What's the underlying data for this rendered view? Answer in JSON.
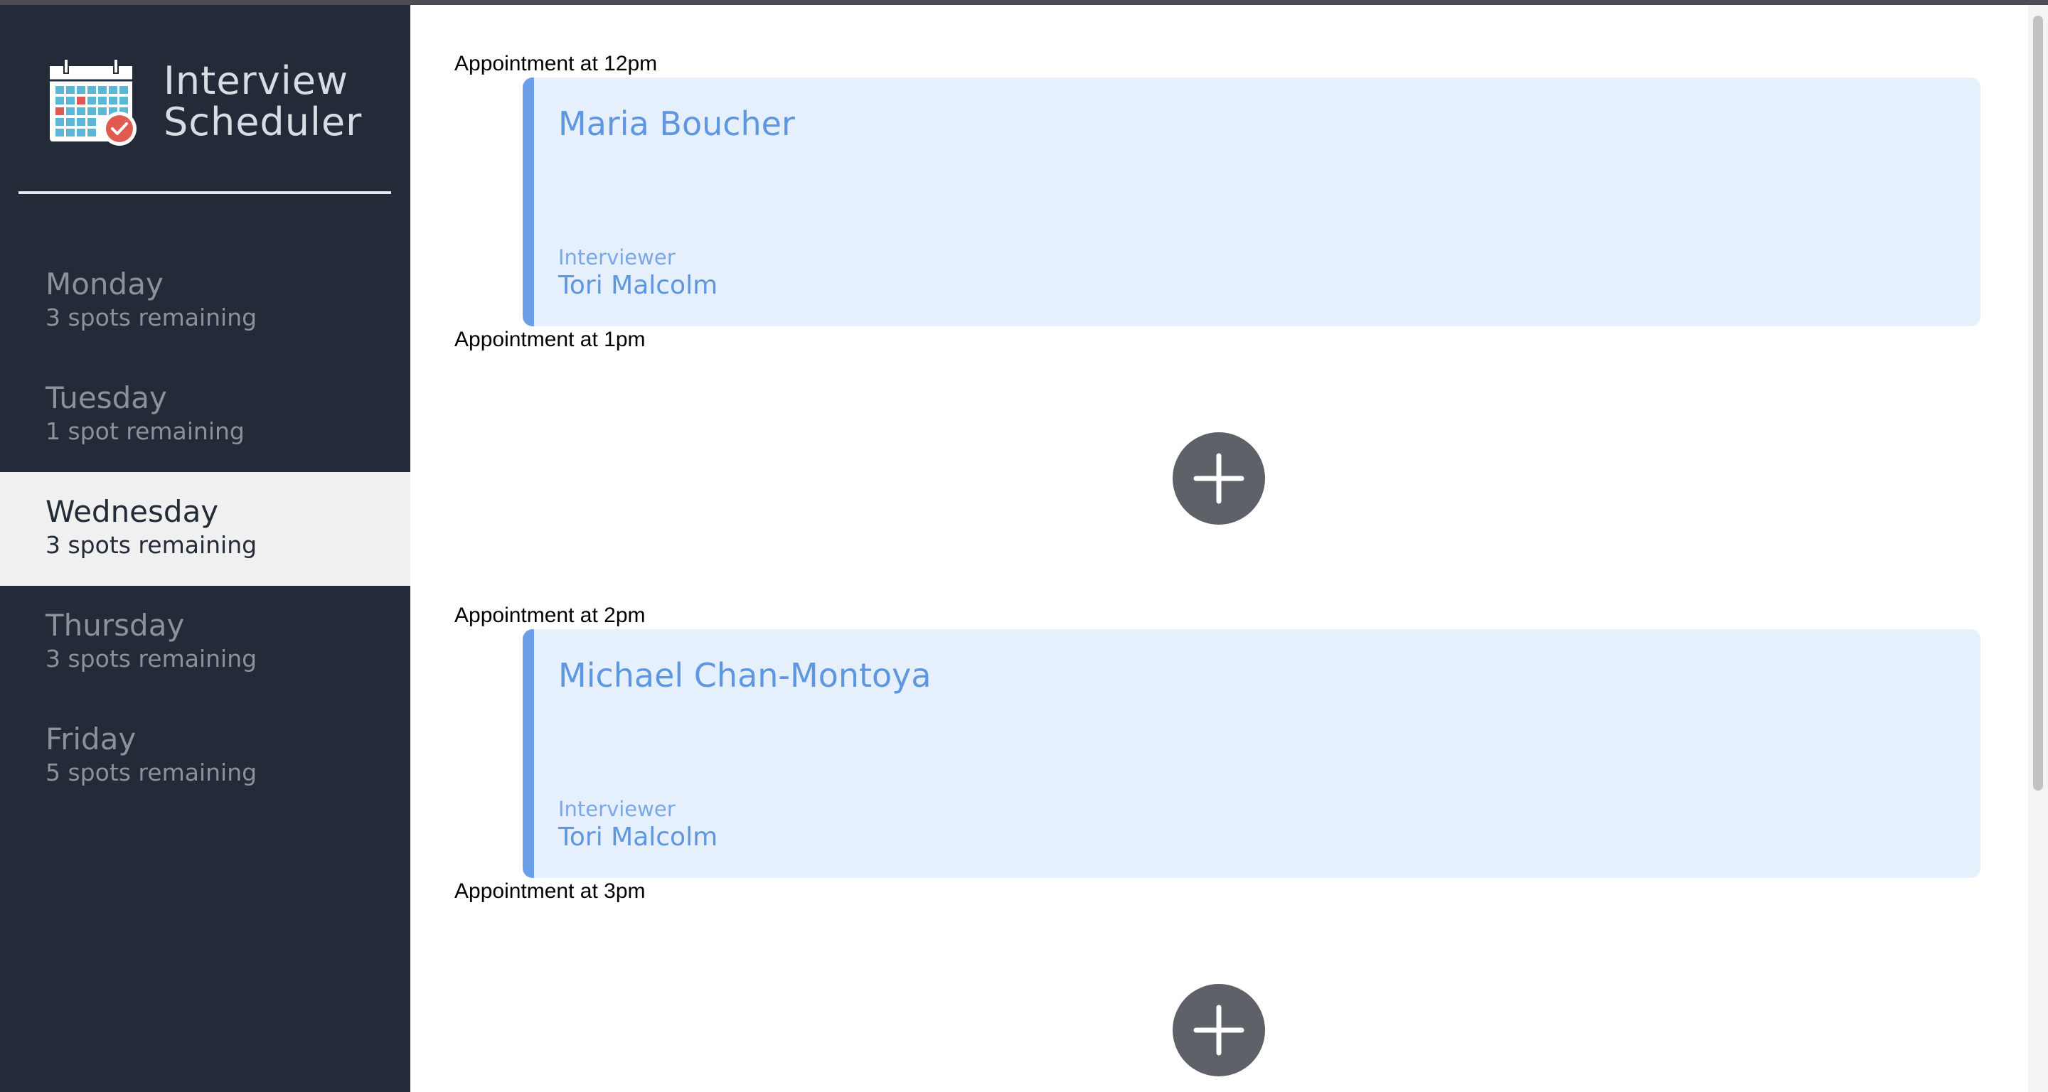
{
  "app": {
    "title_line1": "Interview",
    "title_line2": "Scheduler",
    "logo_icon": "calendar-check-icon"
  },
  "sidebar": {
    "days": [
      {
        "name": "Monday",
        "spots": "3 spots remaining",
        "selected": false
      },
      {
        "name": "Tuesday",
        "spots": "1 spot remaining",
        "selected": false
      },
      {
        "name": "Wednesday",
        "spots": "3 spots remaining",
        "selected": true
      },
      {
        "name": "Thursday",
        "spots": "3 spots remaining",
        "selected": false
      },
      {
        "name": "Friday",
        "spots": "5 spots remaining",
        "selected": false
      }
    ]
  },
  "schedule": {
    "appointments": [
      {
        "time_label": "Appointment at 12pm",
        "booked": true,
        "student": "Maria Boucher",
        "interviewer_label": "Interviewer",
        "interviewer": "Tori Malcolm"
      },
      {
        "time_label": "Appointment at 1pm",
        "booked": false,
        "add_icon": "plus-icon"
      },
      {
        "time_label": "Appointment at 2pm",
        "booked": true,
        "student": "Michael Chan-Montoya",
        "interviewer_label": "Interviewer",
        "interviewer": "Tori Malcolm"
      },
      {
        "time_label": "Appointment at 3pm",
        "booked": false,
        "add_icon": "plus-icon"
      }
    ]
  },
  "colors": {
    "sidebar_bg": "#222b37",
    "selected_day_bg": "#f0f0f0",
    "card_bg": "#e6effc",
    "card_accent": "#6ba0e8",
    "card_text": "#5d96e1",
    "add_button": "#5f6168"
  }
}
